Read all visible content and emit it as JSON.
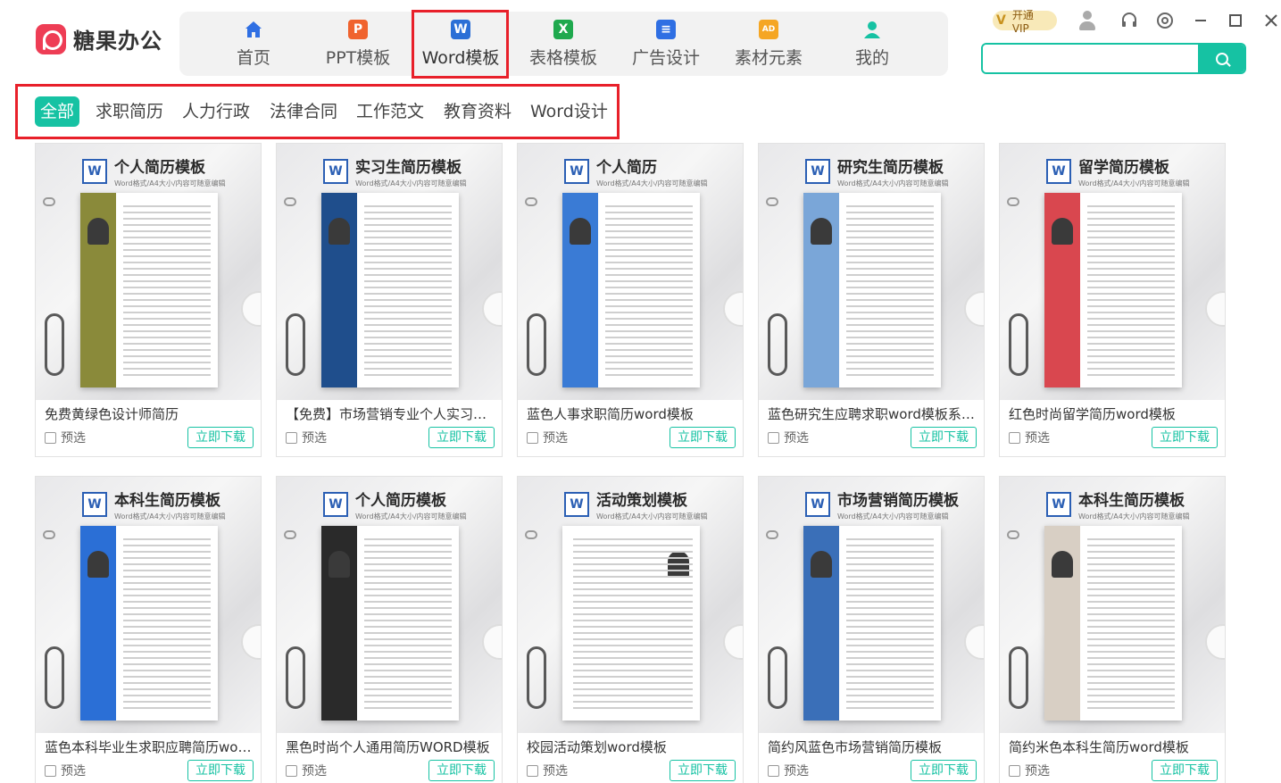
{
  "app": {
    "logo_text": "糖果办公"
  },
  "nav": {
    "items": [
      {
        "label": "首页",
        "icon": "home-icon",
        "color": "#2f6fe3"
      },
      {
        "label": "PPT模板",
        "icon": "ppt-icon",
        "color": "#f0632e"
      },
      {
        "label": "Word模板",
        "icon": "word-icon",
        "color": "#2b6fd6"
      },
      {
        "label": "表格模板",
        "icon": "excel-icon",
        "color": "#1fa94e"
      },
      {
        "label": "广告设计",
        "icon": "layers-icon",
        "color": "#2f6fe3"
      },
      {
        "label": "素材元素",
        "icon": "image-icon",
        "color": "#f5a623"
      },
      {
        "label": "我的",
        "icon": "user-icon",
        "color": "#16c2a3"
      }
    ],
    "active": "Word模板"
  },
  "topbar": {
    "vip_label": "开通VIP"
  },
  "search": {
    "placeholder": "",
    "value": ""
  },
  "categories": [
    {
      "label": "全部",
      "active": true
    },
    {
      "label": "求职简历"
    },
    {
      "label": "人力行政"
    },
    {
      "label": "法律合同"
    },
    {
      "label": "工作范文"
    },
    {
      "label": "教育资料"
    },
    {
      "label": "Word设计"
    }
  ],
  "cards": [
    {
      "thumb_title": "个人简历模板",
      "thumb_sub": "Word格式/A4大小/内容可随意编辑",
      "title": "免费黄绿色设计师简历",
      "accent": "#8a8a3a"
    },
    {
      "thumb_title": "实习生简历模板",
      "thumb_sub": "Word格式/A4大小/内容可随意编辑",
      "title": "【免费】市场营销专业个人实习简历",
      "accent": "#1f4e8c"
    },
    {
      "thumb_title": "个人简历",
      "thumb_sub": "Word格式/A4大小/内容可随意编辑",
      "title": "蓝色人事求职简历word模板",
      "accent": "#3a7bd5"
    },
    {
      "thumb_title": "研究生简历模板",
      "thumb_sub": "Word格式/A4大小/内容可随意编辑",
      "title": "蓝色研究生应聘求职word模板系列简历",
      "accent": "#7aa6d8"
    },
    {
      "thumb_title": "留学简历模板",
      "thumb_sub": "Word格式/A4大小/内容可随意编辑",
      "title": "红色时尚留学简历word模板",
      "accent": "#d9474f"
    },
    {
      "thumb_title": "本科生简历模板",
      "thumb_sub": "Word格式/A4大小/内容可随意编辑",
      "title": "蓝色本科毕业生求职应聘简历word模板",
      "accent": "#2b6fd6"
    },
    {
      "thumb_title": "个人简历模板",
      "thumb_sub": "Word格式/A4大小/内容可随意编辑",
      "title": "黑色时尚个人通用简历WORD模板",
      "accent": "#2a2a2a"
    },
    {
      "thumb_title": "活动策划模板",
      "thumb_sub": "Word格式/A4大小/内容可随意编辑",
      "title": "校园活动策划word模板",
      "accent": "#ffffff"
    },
    {
      "thumb_title": "市场营销简历模板",
      "thumb_sub": "Word格式/A4大小/内容可随意编辑",
      "title": "简约风蓝色市场营销简历模板",
      "accent": "#3a6fb8"
    },
    {
      "thumb_title": "本科生简历模板",
      "thumb_sub": "Word格式/A4大小/内容可随意编辑",
      "title": "简约米色本科生简历word模板",
      "accent": "#d8cfc4"
    }
  ],
  "card_labels": {
    "preview": "预选",
    "download": "立即下载"
  }
}
